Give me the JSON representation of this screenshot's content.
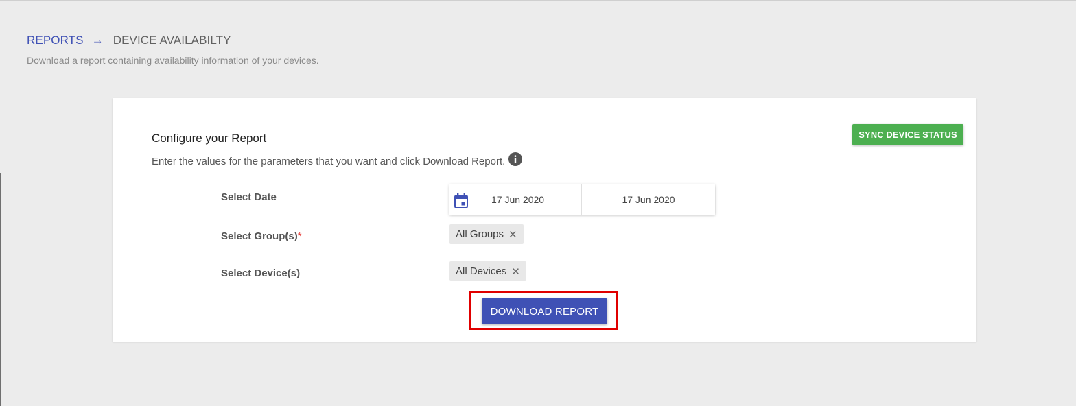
{
  "breadcrumb": {
    "parent": "REPORTS",
    "arrow": "→",
    "current": "DEVICE AVAILABILTY"
  },
  "page": {
    "subtitle": "Download a report containing availability information of your devices."
  },
  "card": {
    "title": "Configure your Report",
    "description": "Enter the values for the parameters that you want and click Download Report.",
    "sync_button": "SYNC DEVICE STATUS"
  },
  "form": {
    "date": {
      "label": "Select Date",
      "start": "17 Jun 2020",
      "end": "17 Jun 2020"
    },
    "groups": {
      "label": "Select Group(s)",
      "required_mark": "*",
      "chips": [
        "All Groups"
      ]
    },
    "devices": {
      "label": "Select Device(s)",
      "chips": [
        "All Devices"
      ]
    },
    "chip_close": "✕",
    "download_button": "DOWNLOAD REPORT"
  },
  "colors": {
    "primary": "#3f51b5",
    "success": "#4caf50",
    "highlight": "#e00000",
    "required": "#e53935"
  },
  "icons": {
    "info": "info-icon",
    "calendar": "calendar-icon",
    "arrow": "arrow-right-icon",
    "close": "close-icon"
  }
}
